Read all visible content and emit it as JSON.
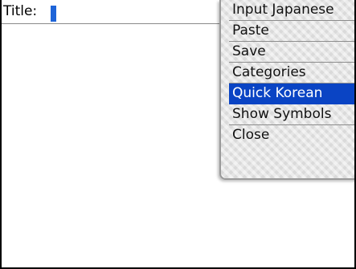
{
  "editor": {
    "title_label": "Title:"
  },
  "menu": {
    "items": [
      {
        "label": "Input Japanese",
        "selected": false
      },
      {
        "label": "Paste",
        "selected": false
      },
      {
        "label": "Save",
        "selected": false
      },
      {
        "label": "Categories",
        "selected": false
      },
      {
        "label": "Quick Korean",
        "selected": true
      },
      {
        "label": "Show Symbols",
        "selected": false
      },
      {
        "label": "Close",
        "selected": false
      }
    ]
  },
  "colors": {
    "cursor": "#1e64d8",
    "selection": "#0a44c4"
  }
}
